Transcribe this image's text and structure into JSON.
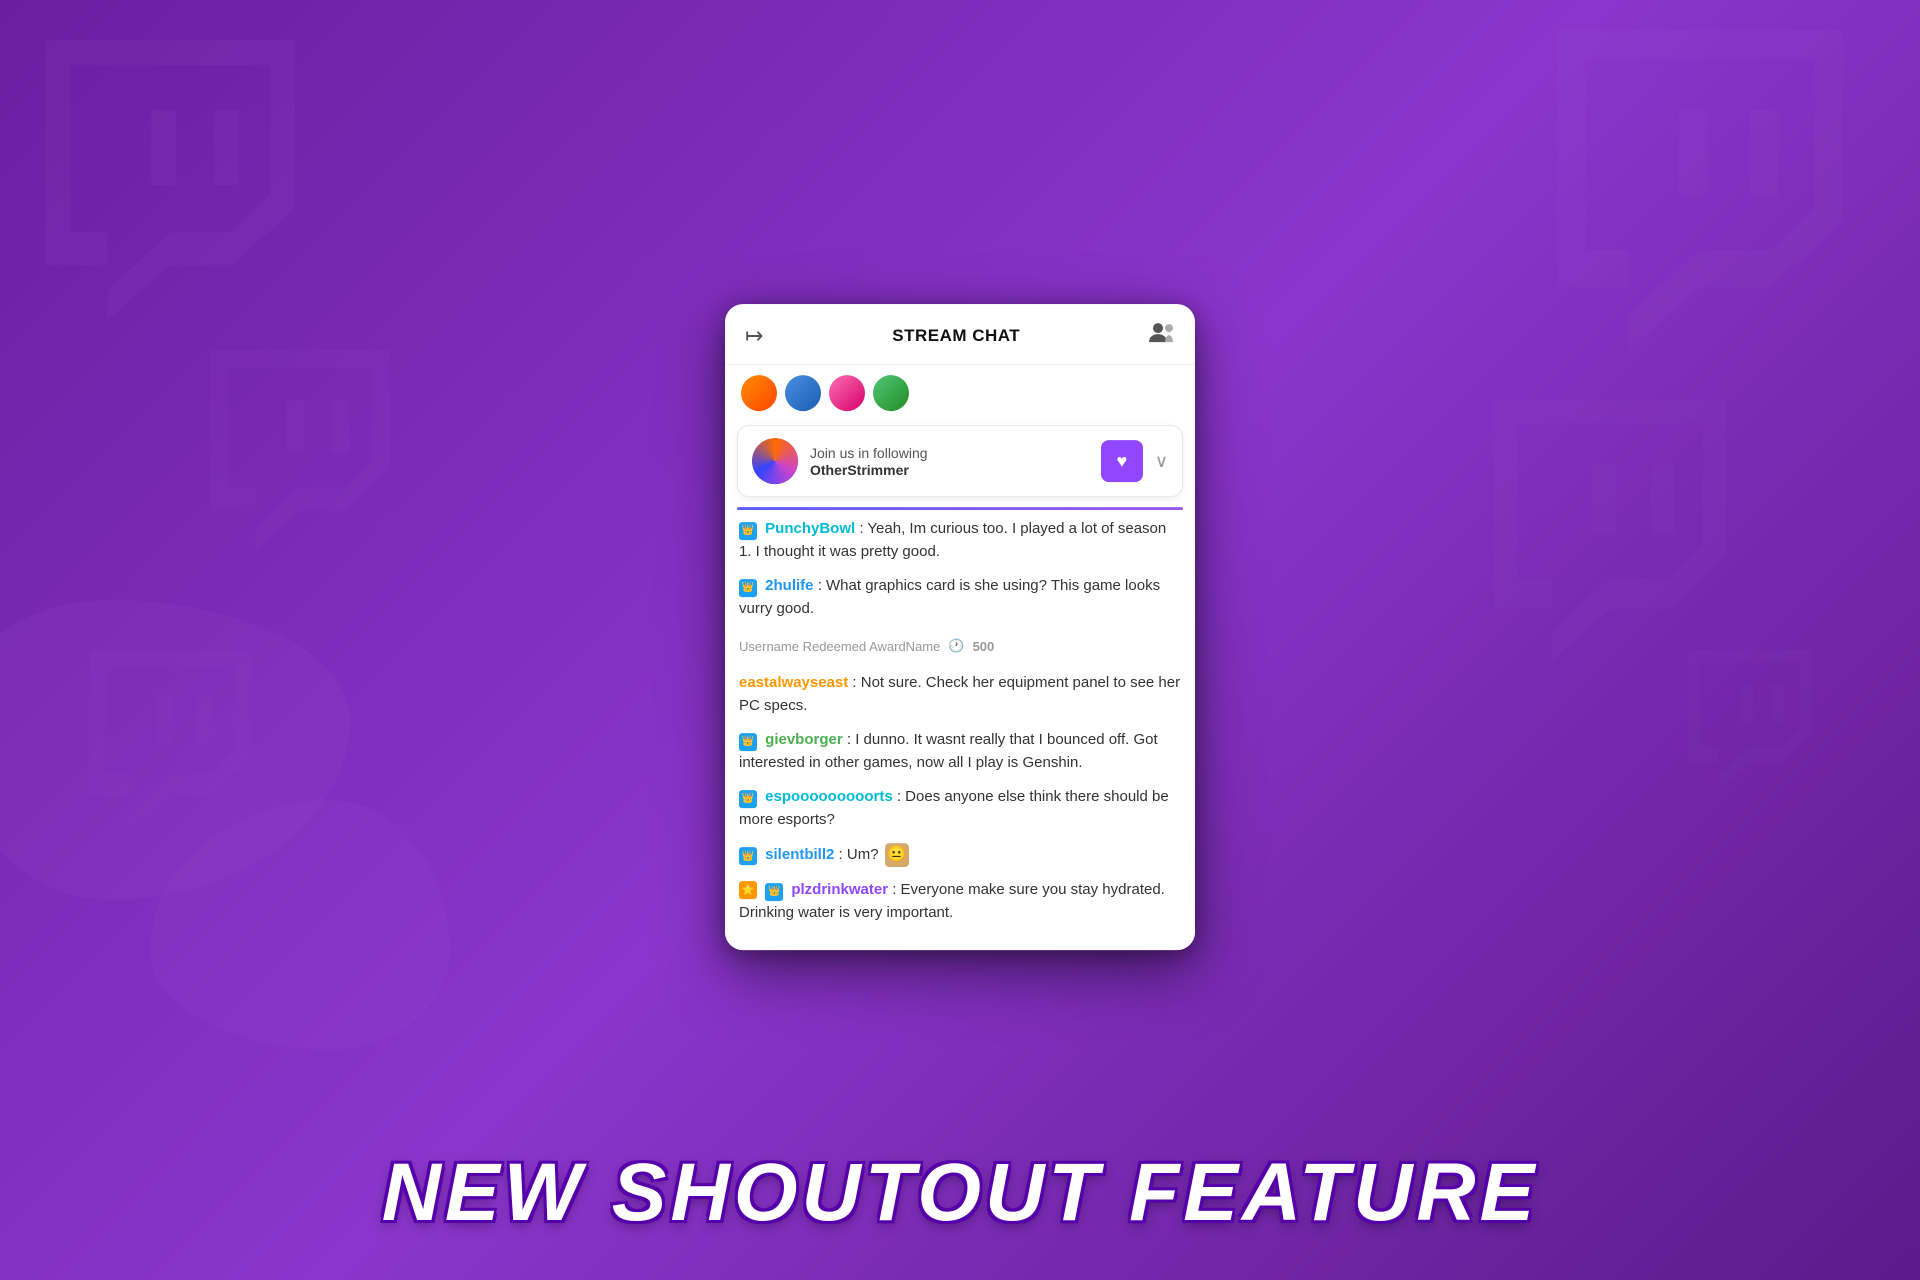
{
  "background": {
    "color": "#7b2fb5"
  },
  "header": {
    "title": "STREAM CHAT",
    "back_icon": "↦",
    "users_icon": "👥"
  },
  "shoutout": {
    "join_text": "Join us in following",
    "streamer_name": "OtherStrimmer",
    "heart_icon": "♥",
    "chevron": "∨"
  },
  "messages": [
    {
      "badge": "crown",
      "username": "PunchyBowl",
      "username_color": "#00bcd4",
      "text": ": Yeah, Im curious too. I played a lot of season 1. I thought it was pretty good."
    },
    {
      "badge": "crown",
      "username": "2hulife",
      "username_color": "#2196f3",
      "text": ": What graphics card is she using? This game looks vurry good."
    },
    {
      "type": "redeemed",
      "text": "Username Redeemed AwardName",
      "points": "500"
    },
    {
      "badge": null,
      "username": "eastalwayseast",
      "username_color": "#ff9800",
      "text": ": Not sure. Check her equipment panel to see her PC specs."
    },
    {
      "badge": "crown",
      "username": "gievborger",
      "username_color": "#4caf50",
      "text": ": I dunno. It wasnt really that I bounced off. Got interested in other games, now all I play is Genshin."
    },
    {
      "badge": "crown",
      "username": "espooooooooorts",
      "username_color": "#00bcd4",
      "text": ": Does anyone else think there should be more esports?"
    },
    {
      "badge": "crown",
      "username": "silentbill2",
      "username_color": "#2196f3",
      "text": ": Um?",
      "has_emote": true
    },
    {
      "badge": "star_crown",
      "username": "plzdrinkwater",
      "username_color": "#9147ff",
      "text": ": Everyone make sure you stay hydrated. Drinking water is very important."
    }
  ],
  "bottom_title": "NEW SHOUTOUT FEATURE"
}
